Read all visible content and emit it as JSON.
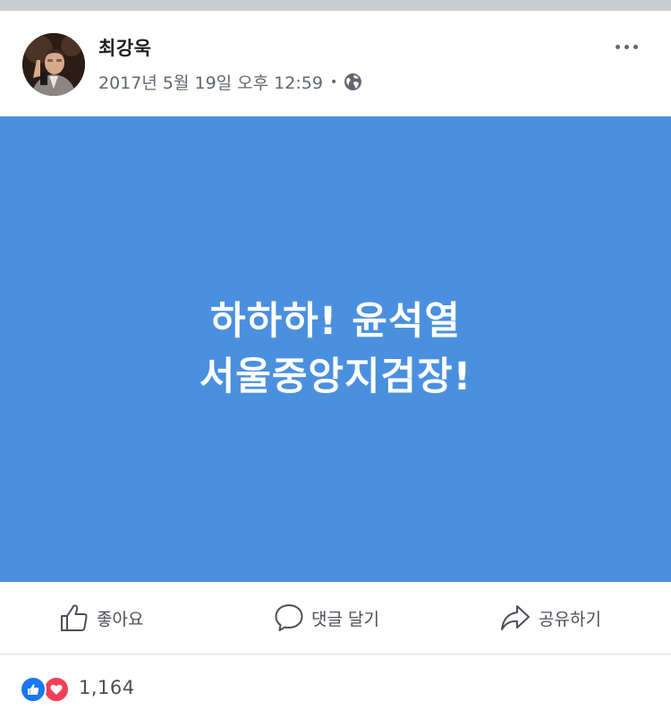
{
  "post": {
    "author": "최강욱",
    "timestamp": "2017년 5월 19일 오후 12:59",
    "separator": "•",
    "privacy_icon": "globe-icon",
    "menu_icon": "more-dots-icon",
    "image_text": {
      "line1": "하하하! 윤석열",
      "line2": "서울중앙지검장!"
    },
    "image_background": "#4a90df"
  },
  "actions": {
    "like_label": "좋아요",
    "like_icon": "thumbs-up-icon",
    "comment_label": "댓글 달기",
    "comment_icon": "speech-bubble-icon",
    "share_label": "공유하기",
    "share_icon": "share-arrow-icon"
  },
  "reactions": {
    "types": [
      "like",
      "love"
    ],
    "count": "1,164",
    "like_color": "#1877f2",
    "love_color": "#f33e58"
  }
}
